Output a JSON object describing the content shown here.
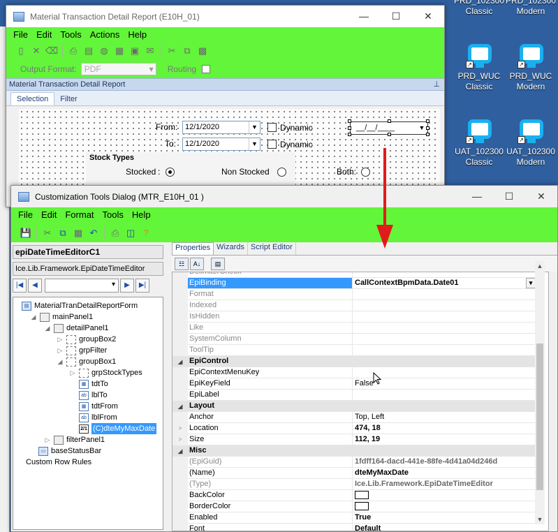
{
  "desktop": {
    "icons": [
      {
        "line1": "PRD_102300",
        "line2": "Classic"
      },
      {
        "line1": "PRD_102300",
        "line2": "Modern"
      },
      {
        "line1": "PRD_WUC",
        "line2": "Classic"
      },
      {
        "line1": "PRD_WUC",
        "line2": "Modern"
      },
      {
        "line1": "UAT_102300",
        "line2": "Classic"
      },
      {
        "line1": "UAT_102300",
        "line2": "Modern"
      }
    ]
  },
  "report_window": {
    "title": "Material Transaction Detail Report (E10H_01)",
    "menu": [
      "File",
      "Edit",
      "Tools",
      "Actions",
      "Help"
    ],
    "output_format_label": "Output Format:",
    "output_format_value": "PDF",
    "routing_label": "Routing",
    "panel_title": "Material Transaction Detail Report",
    "tabs": [
      "Selection",
      "Filter"
    ],
    "from_label": "From:",
    "from_value": "12/1/2020",
    "to_label": "To:",
    "to_value": "12/1/2020",
    "dynamic_label": "Dynamic",
    "max_date_value": "__/__/____",
    "stock_types_title": "Stock Types",
    "stocked_label": "Stocked",
    "non_stocked_label": "Non Stocked",
    "both_label": "Both:"
  },
  "dialog": {
    "title": "Customization Tools Dialog  (MTR_E10H_01 )",
    "menu": [
      "File",
      "Edit",
      "Format",
      "Tools",
      "Help"
    ],
    "control_name": "epiDateTimeEditorC1",
    "control_type": "Ice.Lib.Framework.EpiDateTimeEditor",
    "tree": [
      {
        "label": "MaterialTranDetailReportForm",
        "icon": "form-icon",
        "exp": ""
      },
      {
        "label": "mainPanel1",
        "icon": "panel-icon",
        "exp": "◢"
      },
      {
        "label": "detailPanel1",
        "icon": "panel-icon",
        "exp": "◢"
      },
      {
        "label": "groupBox2",
        "icon": "groupbox-icon",
        "exp": "▷"
      },
      {
        "label": "grpFilter",
        "icon": "groupbox-icon",
        "exp": "▷"
      },
      {
        "label": "groupBox1",
        "icon": "groupbox-icon",
        "exp": "◢"
      },
      {
        "label": "grpStockTypes",
        "icon": "groupbox-icon",
        "exp": "▷"
      },
      {
        "label": "tdtTo",
        "icon": "textbox-icon",
        "exp": ""
      },
      {
        "label": "lblTo",
        "icon": "label-icon",
        "exp": ""
      },
      {
        "label": "tdtFrom",
        "icon": "textbox-icon",
        "exp": ""
      },
      {
        "label": "lblFrom",
        "icon": "label-icon",
        "exp": ""
      },
      {
        "label": "(C)dteMyMaxDate",
        "icon": "date-icon",
        "exp": ""
      },
      {
        "label": "filterPanel1",
        "icon": "panel-icon",
        "exp": "▷"
      },
      {
        "label": "baseStatusBar",
        "icon": "statusbar-icon",
        "exp": ""
      },
      {
        "label": "Custom Row Rules",
        "icon": "",
        "exp": ""
      }
    ],
    "right_tabs": [
      "Properties",
      "Wizards",
      "Script Editor"
    ],
    "properties": [
      {
        "name": "DelimiterCheck",
        "value": "",
        "kind": "dim"
      },
      {
        "name": "EpiBinding",
        "value": "CallContextBpmData.Date01",
        "kind": "selected"
      },
      {
        "name": "Format",
        "value": "",
        "kind": "dim"
      },
      {
        "name": "Indexed",
        "value": "",
        "kind": "dim"
      },
      {
        "name": "IsHidden",
        "value": "",
        "kind": "dim"
      },
      {
        "name": "Like",
        "value": "",
        "kind": "dim"
      },
      {
        "name": "SystemColumn",
        "value": "",
        "kind": "dim"
      },
      {
        "name": "ToolTip",
        "value": "",
        "kind": "dim"
      },
      {
        "name": "EpiControl",
        "value": "",
        "kind": "cat"
      },
      {
        "name": "EpiContextMenuKey",
        "value": "",
        "kind": "normal"
      },
      {
        "name": "EpiKeyField",
        "value": "False",
        "kind": "normal"
      },
      {
        "name": "EpiLabel",
        "value": "",
        "kind": "normal"
      },
      {
        "name": "Layout",
        "value": "",
        "kind": "cat"
      },
      {
        "name": "Anchor",
        "value": "Top, Left",
        "kind": "normal"
      },
      {
        "name": "Location",
        "value": "474, 18",
        "kind": "bold",
        "exp": ">"
      },
      {
        "name": "Size",
        "value": "112, 19",
        "kind": "bold",
        "exp": ">"
      },
      {
        "name": "Misc",
        "value": "",
        "kind": "cat"
      },
      {
        "name": "(EpiGuid)",
        "value": "1fdff164-dacd-441e-88fe-4d41a04d246d",
        "kind": "grey"
      },
      {
        "name": "(Name)",
        "value": "dteMyMaxDate",
        "kind": "bold"
      },
      {
        "name": "(Type)",
        "value": "Ice.Lib.Framework.EpiDateTimeEditor",
        "kind": "grey"
      },
      {
        "name": "BackColor",
        "value": "",
        "kind": "swatch"
      },
      {
        "name": "BorderColor",
        "value": "",
        "kind": "swatch"
      },
      {
        "name": "Enabled",
        "value": "True",
        "kind": "bold"
      },
      {
        "name": "Font",
        "value": "Default",
        "kind": "bold"
      }
    ]
  },
  "colors": {
    "toolbar_green": "#63f53a",
    "selection_blue": "#3399ff",
    "arrow_red": "#e11b1b"
  }
}
